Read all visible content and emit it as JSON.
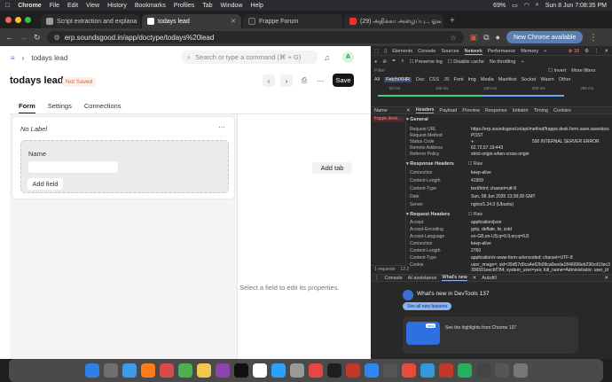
{
  "menubar": {
    "apple": "",
    "app": "Chrome",
    "items": [
      "File",
      "Edit",
      "View",
      "History",
      "Bookmarks",
      "Profiles",
      "Tab",
      "Window",
      "Help"
    ],
    "battery": "69%",
    "datetime": "Sun 8 Jun  7:08:35 PM"
  },
  "tabs": [
    {
      "label": "Script extraction and explana",
      "active": false,
      "color": "#9c9c9c"
    },
    {
      "label": "todays lead",
      "active": true,
      "color": "#ffffff"
    },
    {
      "label": "Frappe Forum",
      "active": false,
      "color": "#333333"
    },
    {
      "label": "(29) அதிக்கா அழைப்பு... ஓடீ",
      "active": false,
      "color": "#ff2b2b"
    }
  ],
  "toolbar": {
    "url": "erp.soundsgood.in/app/doctype/todays%20lead",
    "chrome_btn": "New Chrome available"
  },
  "app": {
    "breadcrumb": "todays lead",
    "search_placeholder": "Search or type a command (⌘ + G)",
    "avatar": "A",
    "title": "todays lead",
    "badge": "Not Saved",
    "save": "Save",
    "tabs": [
      "Form",
      "Settings",
      "Connections"
    ],
    "add_tab": "Add tab",
    "section_label": "No Label",
    "field_label": "Name",
    "add_field": "Add field",
    "hint": "Select a field to edit its properties."
  },
  "devtools": {
    "top_tabs": [
      "Elements",
      "Console",
      "Sources",
      "Network",
      "Performance",
      "Memory"
    ],
    "filter_row": [
      "Preserve log",
      "Disable cache",
      "No throttling"
    ],
    "filter_placeholder": "Filter",
    "invert": "Invert",
    "more_filters": "More filters",
    "types": [
      "All",
      "Fetch/XHR",
      "Doc",
      "CSS",
      "JS",
      "Font",
      "Img",
      "Media",
      "Manifest",
      "Socket",
      "Wasm",
      "Other"
    ],
    "timeline": [
      "50 ms",
      "100 ms",
      "150 ms",
      "200 ms",
      "250 ms"
    ],
    "name_col": "Name",
    "request_name": "frappe.desk...",
    "detail_tabs": [
      "Headers",
      "Payload",
      "Preview",
      "Response",
      "Initiator",
      "Timing",
      "Cookies"
    ],
    "general": "General",
    "general_rows": [
      [
        "Request URL",
        "https://erp.soundsgood.in/api/method/frappe.desk.form.save.savedocs"
      ],
      [
        "Request Method",
        "POST"
      ],
      [
        "Status Code",
        "500 INTERNAL SERVER ERROR"
      ],
      [
        "Remote Address",
        "62.72.57.19:443"
      ],
      [
        "Referrer Policy",
        "strict-origin-when-cross-origin"
      ]
    ],
    "resp_headers": "Response Headers",
    "raw": "Raw",
    "resp_rows": [
      [
        "Connection",
        "keep-alive"
      ],
      [
        "Content-Length",
        "41959"
      ],
      [
        "Content-Type",
        "text/html; charset=utf-8"
      ],
      [
        "Date",
        "Sun, 08 Jun 2025 13:38:28 GMT"
      ],
      [
        "Server",
        "nginx/1.24.0 (Ubuntu)"
      ]
    ],
    "req_headers": "Request Headers",
    "req_rows": [
      [
        "Accept",
        "application/json"
      ],
      [
        "Accept-Encoding",
        "gzip, deflate, br, zstd"
      ],
      [
        "Accept-Language",
        "en-GB,en-US;q=0.9,en;q=0.8"
      ],
      [
        "Connection",
        "keep-alive"
      ],
      [
        "Content-Length",
        "2760"
      ],
      [
        "Content-Type",
        "application/x-www-form-urlencoded; charset=UTF-8"
      ],
      [
        "Cookie",
        "user_image=; sid=39d57d0ca4e62b09ca0eeda1846096eb296cd10ec3306591eecbf784; system_user=yes; full_name=Administrator; user_id=Administrator"
      ]
    ],
    "status_bar": [
      "1 requests",
      "12.2"
    ],
    "drawer_tabs": [
      "Console",
      "AI assistance",
      "What's new",
      "Autofill"
    ],
    "whats_new": "What's new in DevTools 137",
    "see_all": "See all new features",
    "highlight": "See the highlights from Chrome 137",
    "new_badge": "new"
  }
}
